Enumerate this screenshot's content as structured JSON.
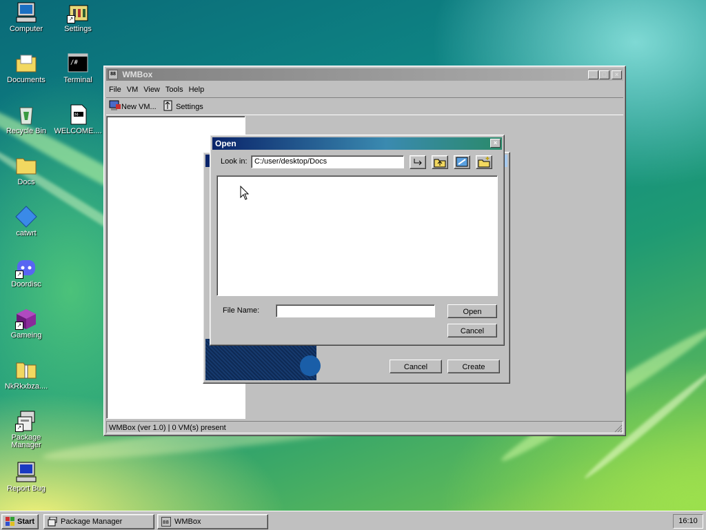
{
  "desktop": {
    "icons": [
      {
        "label": "Computer",
        "icon": "computer-icon"
      },
      {
        "label": "Settings",
        "icon": "settings-icon"
      },
      {
        "label": "Documents",
        "icon": "documents-folder-icon"
      },
      {
        "label": "Terminal",
        "icon": "terminal-icon"
      },
      {
        "label": "Recycle Bin",
        "icon": "recycle-bin-icon"
      },
      {
        "label": "WELCOME....",
        "icon": "text-file-icon"
      },
      {
        "label": "Docs",
        "icon": "folder-icon"
      },
      {
        "label": "catwrt",
        "icon": "diamond-icon"
      },
      {
        "label": "Doordisc",
        "icon": "discord-icon"
      },
      {
        "label": "Gameing",
        "icon": "cube-icon"
      },
      {
        "label": "NkRkxbza....",
        "icon": "zip-folder-icon"
      },
      {
        "label": "Package Manager",
        "icon": "package-manager-icon"
      },
      {
        "label": "Report Bug",
        "icon": "report-bug-icon"
      }
    ]
  },
  "wmbox": {
    "title": "WMBox",
    "menu": [
      "File",
      "VM",
      "View",
      "Tools",
      "Help"
    ],
    "toolbar": {
      "new_vm": "New VM...",
      "settings": "Settings"
    },
    "status": "WMBox (ver 1.0) | 0 VM(s) present"
  },
  "new_vm_dialog": {
    "cancel": "Cancel",
    "create": "Create"
  },
  "open_dialog": {
    "title": "Open",
    "look_in_label": "Look in:",
    "path": "C:/user/desktop/Docs",
    "file_name_label": "File Name:",
    "file_name_value": "",
    "open_button": "Open",
    "cancel_button": "Cancel"
  },
  "taskbar": {
    "start": "Start",
    "tasks": [
      "Package Manager",
      "WMBox"
    ],
    "clock": "16:10"
  },
  "colors": {
    "title_active": "#0a246a",
    "title_inactive": "#808080",
    "face": "#c0c0c0"
  }
}
